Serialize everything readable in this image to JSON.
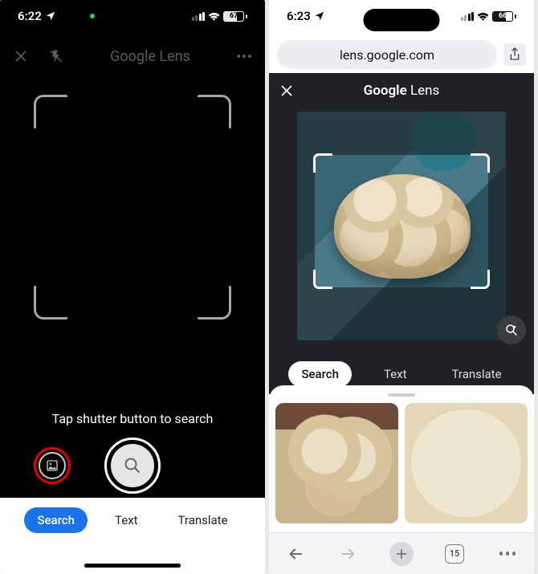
{
  "phoneA": {
    "status": {
      "time": "6:22",
      "battery_pct": "67",
      "battery_fill_pct": 67
    },
    "header": {
      "title": "Google Lens"
    },
    "hint": "Tap shutter button to search",
    "footer_tabs": [
      {
        "label": "Search",
        "active": true
      },
      {
        "label": "Text",
        "active": false
      },
      {
        "label": "Translate",
        "active": false
      }
    ]
  },
  "phoneB": {
    "status": {
      "time": "6:23",
      "battery_pct": "66",
      "battery_fill_pct": 66
    },
    "url": "lens.google.com",
    "header": {
      "title_prefix": "Google",
      "title_suffix": " Lens"
    },
    "mode_tabs": [
      {
        "label": "Search",
        "active": true
      },
      {
        "label": "Text",
        "active": false
      },
      {
        "label": "Translate",
        "active": false
      }
    ],
    "safari": {
      "open_tabs": "15"
    }
  }
}
